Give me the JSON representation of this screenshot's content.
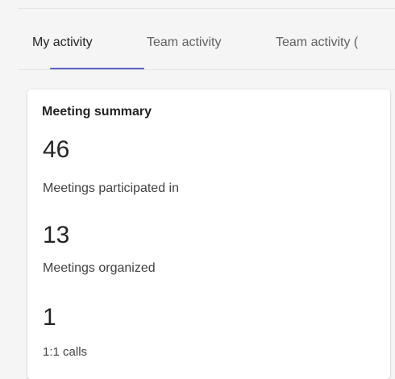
{
  "tabs": [
    {
      "label": "My activity",
      "active": true
    },
    {
      "label": "Team activity",
      "active": false
    },
    {
      "label": "Team activity (",
      "active": false
    }
  ],
  "accent_color": "#5b5fc7",
  "card": {
    "title": "Meeting summary",
    "metrics": [
      {
        "value": "46",
        "label": "Meetings participated in"
      },
      {
        "value": "13",
        "label": "Meetings organized"
      },
      {
        "value": "1",
        "label": "1:1 calls"
      }
    ]
  }
}
